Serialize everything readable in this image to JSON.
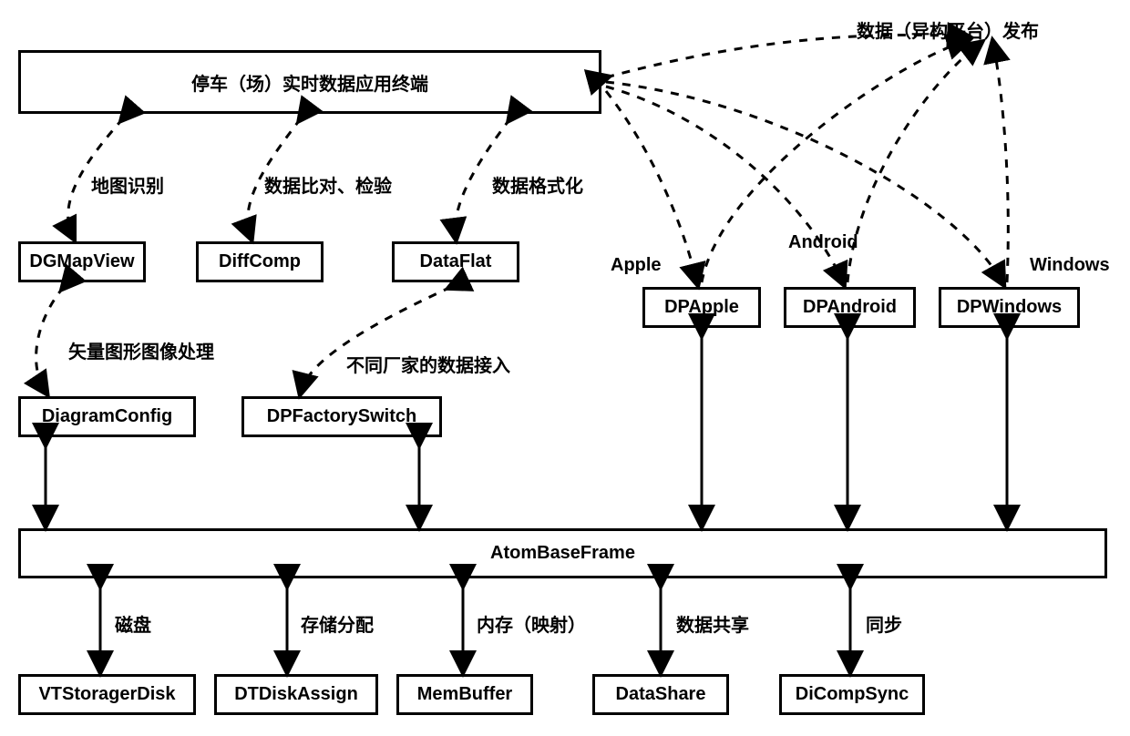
{
  "titleTop": "数据（异构平台）发布",
  "appTerminal": "停车（场）实时数据应用终端",
  "labels": {
    "mapRecog": "地图识别",
    "dataCompare": "数据比对、检验",
    "dataFormat": "数据格式化",
    "vectorImg": "矢量图形图像处理",
    "factoryAccess": "不同厂家的数据接入",
    "apple": "Apple",
    "android": "Android",
    "windows": "Windows",
    "disk": "磁盘",
    "storeAlloc": "存储分配",
    "memMap": "内存（映射）",
    "dataShare": "数据共享",
    "sync": "同步"
  },
  "nodes": {
    "dgmapview": "DGMapView",
    "diffcomp": "DiffComp",
    "dataflat": "DataFlat",
    "diagramconfig": "DiagramConfig",
    "dpfactoryswitch": "DPFactorySwitch",
    "dpapple": "DPApple",
    "dpandroid": "DPAndroid",
    "dpwindows": "DPWindows",
    "atombaseframe": "AtomBaseFrame",
    "vtstoragerdisk": "VTStoragerDisk",
    "dtdiskassign": "DTDiskAssign",
    "membuffer": "MemBuffer",
    "datashare": "DataShare",
    "dicompsync": "DiCompSync"
  }
}
